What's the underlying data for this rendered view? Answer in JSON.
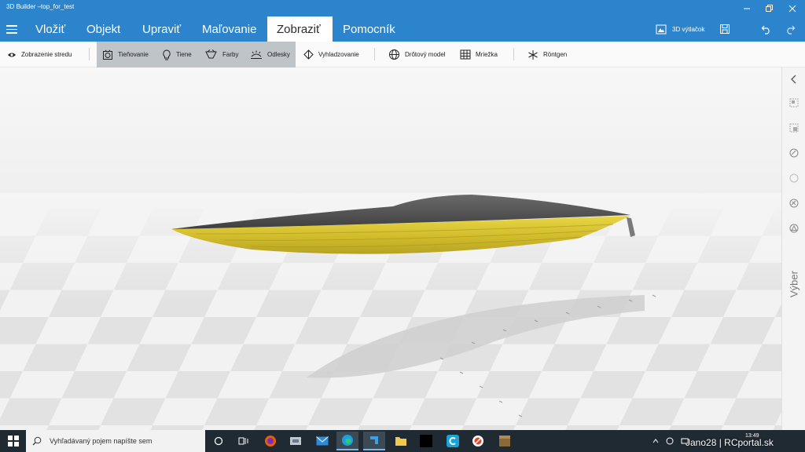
{
  "window": {
    "title": "3D Builder –top_for_test"
  },
  "menu": {
    "items": [
      "Vložiť",
      "Objekt",
      "Upraviť",
      "Maľovanie",
      "Zobraziť",
      "Pomocník"
    ],
    "active": "Zobraziť",
    "print_label": "3D výtlačok"
  },
  "ribbon": {
    "center_view": "Zobrazenie stredu",
    "shading": "Tieňovanie",
    "shadows": "Tiene",
    "colors": "Farby",
    "reflections": "Odlesky",
    "smoothing": "Vyhladzovanie",
    "wireframe": "Drôtový model",
    "grid": "Mriežka",
    "xray": "Röntgen"
  },
  "right_panel": {
    "label": "Výber"
  },
  "model": {
    "hull_color": "#d6c12d",
    "deck_color": "#5a5a5a"
  },
  "taskbar": {
    "search_placeholder": "Vyhľadávaný pojem napíšte sem",
    "clock_time": "13:49"
  },
  "watermark": "Jano28 | RCportal.sk"
}
